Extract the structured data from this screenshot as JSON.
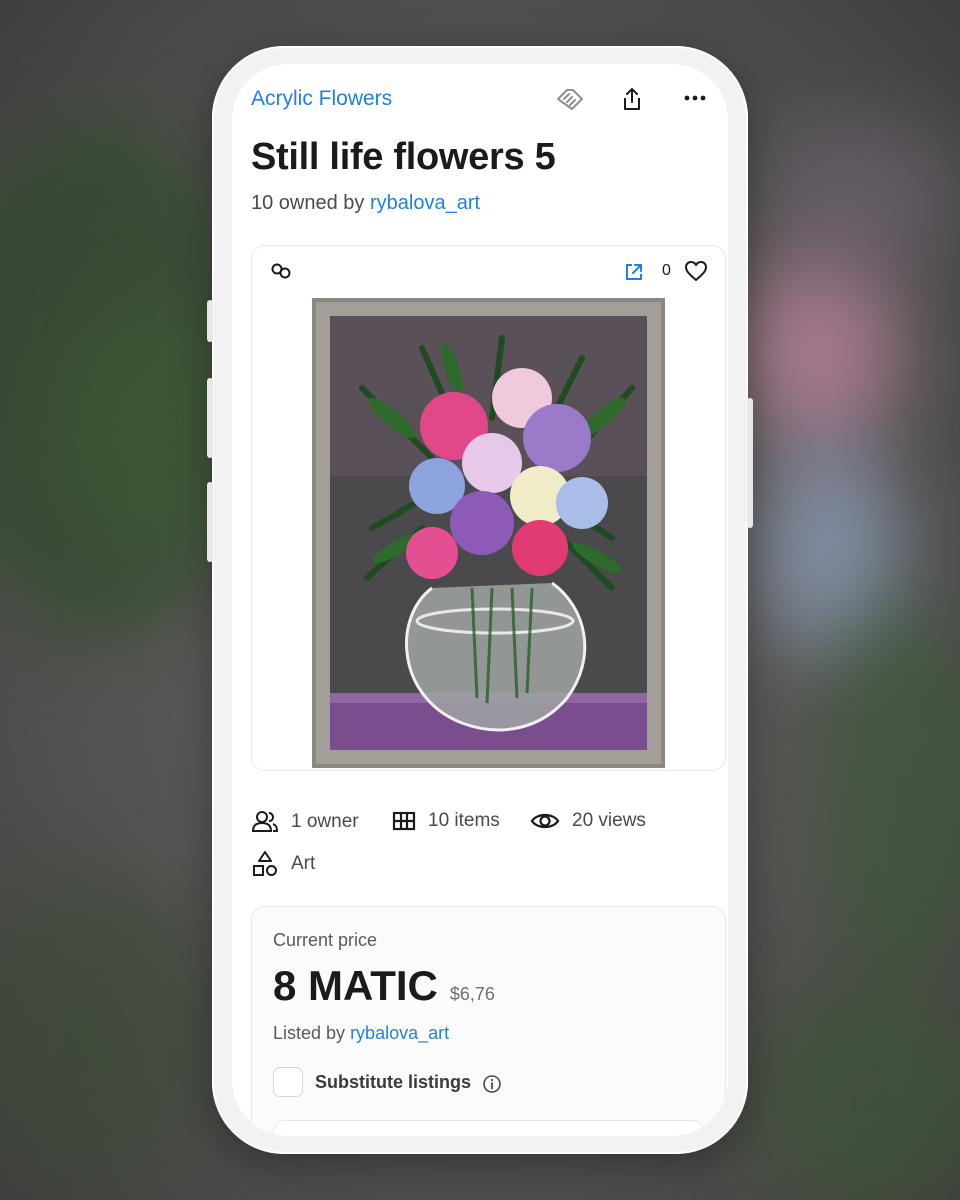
{
  "collection": {
    "name": "Acrylic Flowers"
  },
  "item": {
    "title": "Still life flowers 5",
    "owned_prefix": "10 owned by",
    "owner": "rybalova_art",
    "favorites": "0"
  },
  "stats": {
    "owners": "1 owner",
    "items": "10 items",
    "views": "20 views",
    "category": "Art"
  },
  "price": {
    "label": "Current price",
    "amount": "8 MATIC",
    "usd": "$6,76",
    "listed_prefix": "Listed by",
    "listed_by": "rybalova_art",
    "substitute_label": "Substitute listings"
  },
  "icons": {
    "top": [
      "handshake-icon",
      "share-icon",
      "more-icon"
    ],
    "card": [
      "polygon-chain-icon",
      "external-link-icon",
      "heart-icon"
    ],
    "stats": [
      "owners-icon",
      "grid-icon",
      "eye-icon",
      "category-shapes-icon",
      "info-icon"
    ]
  },
  "colors": {
    "accent": "#2081e2",
    "text": "#1b1b1b"
  }
}
